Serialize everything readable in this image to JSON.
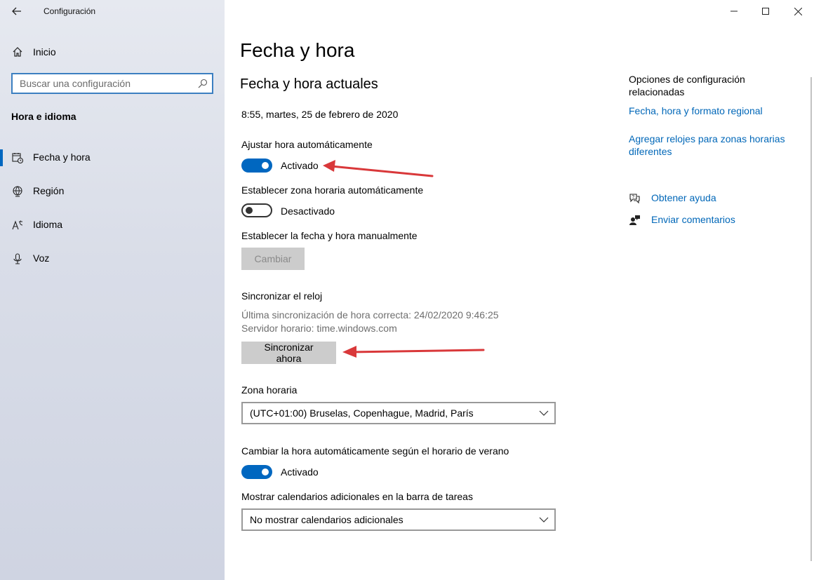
{
  "window": {
    "app_title": "Configuración",
    "controls": {
      "minimize": "minimize-icon",
      "maximize": "maximize-icon",
      "close": "close-icon"
    }
  },
  "sidebar": {
    "home_label": "Inicio",
    "search": {
      "placeholder": "Buscar una configuración"
    },
    "section_title": "Hora e idioma",
    "items": [
      {
        "label": "Fecha y hora",
        "icon": "calendar-clock-icon",
        "active": true
      },
      {
        "label": "Región",
        "icon": "globe-icon",
        "active": false
      },
      {
        "label": "Idioma",
        "icon": "language-icon",
        "active": false
      },
      {
        "label": "Voz",
        "icon": "microphone-icon",
        "active": false
      }
    ]
  },
  "main": {
    "page_title": "Fecha y hora",
    "subtitle": "Fecha y hora actuales",
    "current_datetime": "8:55, martes, 25 de febrero de 2020",
    "auto_time": {
      "label": "Ajustar hora automáticamente",
      "state": "Activado",
      "on": true
    },
    "auto_timezone": {
      "label": "Establecer zona horaria automáticamente",
      "state": "Desactivado",
      "on": false
    },
    "manual": {
      "label": "Establecer la fecha y hora manualmente",
      "button": "Cambiar"
    },
    "sync": {
      "label": "Sincronizar el reloj",
      "last_sync": "Última sincronización de hora correcta: 24/02/2020 9:46:25",
      "server": "Servidor horario: time.windows.com",
      "button": "Sincronizar ahora"
    },
    "timezone": {
      "label": "Zona horaria",
      "value": "(UTC+01:00) Bruselas, Copenhague, Madrid, París"
    },
    "dst": {
      "label": "Cambiar la hora automáticamente según el horario de verano",
      "state": "Activado",
      "on": true
    },
    "calendars": {
      "label": "Mostrar calendarios adicionales en la barra de tareas",
      "value": "No mostrar calendarios adicionales"
    }
  },
  "related": {
    "title": "Opciones de configuración relacionadas",
    "links": [
      "Fecha, hora y formato regional",
      "Agregar relojes para zonas horarias diferentes"
    ],
    "help": [
      {
        "label": "Obtener ayuda",
        "icon": "help-chat-icon"
      },
      {
        "label": "Enviar comentarios",
        "icon": "feedback-icon"
      }
    ]
  },
  "colors": {
    "accent": "#0067c0",
    "link": "#0067b8",
    "annotation_arrow": "#d9383a"
  }
}
